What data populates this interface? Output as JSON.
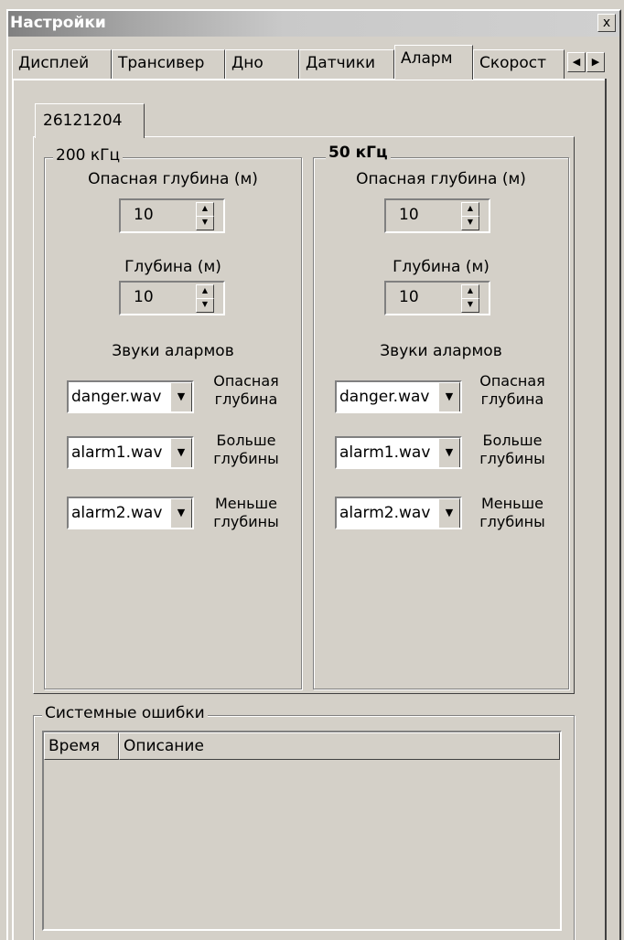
{
  "window": {
    "title": "Настройки",
    "close_label": "x"
  },
  "tabs": [
    {
      "label": "Дисплей"
    },
    {
      "label": "Трансивер"
    },
    {
      "label": "Дно"
    },
    {
      "label": "Датчики"
    },
    {
      "label": "Аларм"
    },
    {
      "label": "Скорост"
    }
  ],
  "tab_scroll": {
    "left": "◀",
    "right": "▶"
  },
  "inner_tab": {
    "label": "26121204"
  },
  "groups": [
    {
      "legend": "200 кГц",
      "danger_depth_label": "Опасная глубина (м)",
      "danger_depth_value": "10",
      "depth_label": "Глубина (м)",
      "depth_value": "10",
      "sounds_label": "Звуки алармов",
      "sounds": [
        {
          "file": "danger.wav",
          "event_line1": "Опасная",
          "event_line2": "глубина"
        },
        {
          "file": "alarm1.wav",
          "event_line1": "Больше",
          "event_line2": "глубины"
        },
        {
          "file": "alarm2.wav",
          "event_line1": "Меньше",
          "event_line2": "глубины"
        }
      ]
    },
    {
      "legend": "50 кГц",
      "danger_depth_label": "Опасная глубина (м)",
      "danger_depth_value": "10",
      "depth_label": "Глубина (м)",
      "depth_value": "10",
      "sounds_label": "Звуки алармов",
      "sounds": [
        {
          "file": "danger.wav",
          "event_line1": "Опасная",
          "event_line2": "глубина"
        },
        {
          "file": "alarm1.wav",
          "event_line1": "Больше",
          "event_line2": "глубины"
        },
        {
          "file": "alarm2.wav",
          "event_line1": "Меньше",
          "event_line2": "глубины"
        }
      ]
    }
  ],
  "errors": {
    "legend": "Системные ошибки",
    "columns": [
      "Время",
      "Описание"
    ]
  }
}
